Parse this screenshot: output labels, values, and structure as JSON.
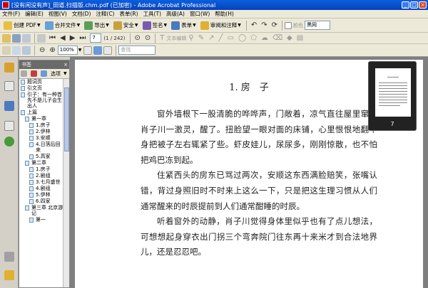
{
  "window": {
    "title": "[没有闲没有声]_田道.扫描版.chm.pdf (已加密) - Adobe Acrobat Professional"
  },
  "menu": [
    "文件(F)",
    "编辑(E)",
    "视图(V)",
    "文档(D)",
    "注释(C)",
    "表单(R)",
    "工具(T)",
    "高级(A)",
    "窗口(W)",
    "帮助(H)"
  ],
  "toolbar1": {
    "create_pdf": "创建 PDF",
    "combine": "合并文件",
    "export": "导出",
    "secure": "安全",
    "sign": "签名",
    "forms": "表单",
    "review": "审阅和注释",
    "color_label": "颜色",
    "color_value": "黑网"
  },
  "toolbar2": {
    "page_current": "7",
    "page_total": "(1 / 242)",
    "text_edit": "文本编辑"
  },
  "toolbar3": {
    "zoom": "100%",
    "search_placeholder": "查找"
  },
  "bookmarks": {
    "title": "书签",
    "close": "×",
    "options": "选项",
    "items": [
      {
        "label": "题词页",
        "level": 0
      },
      {
        "label": "引文页",
        "level": 0
      },
      {
        "label": "引子：有一种首先不是儿子会生出人",
        "level": 0
      },
      {
        "label": "上篇",
        "level": 0
      },
      {
        "label": "第一章",
        "level": 1
      },
      {
        "label": "1.房子",
        "level": 2
      },
      {
        "label": "2.伊林",
        "level": 2
      },
      {
        "label": "3.安顺",
        "level": 2
      },
      {
        "label": "4.日落后回来",
        "level": 2
      },
      {
        "label": "5.高家",
        "level": 2
      },
      {
        "label": "第二章",
        "level": 1
      },
      {
        "label": "1.房子",
        "level": 2
      },
      {
        "label": "2.剧组",
        "level": 2
      },
      {
        "label": "3.七月盛世",
        "level": 2
      },
      {
        "label": "4.剧组",
        "level": 2
      },
      {
        "label": "5.伊林",
        "level": 2
      },
      {
        "label": "6.四家",
        "level": 2
      },
      {
        "label": "第三章 北京游记",
        "level": 1
      },
      {
        "label": "第一",
        "level": 2
      }
    ]
  },
  "document": {
    "heading": "1. 房　子",
    "paragraphs": [
      "窗外墙根下一股清脆的哗哗声，门敞着，凉气直往屋里窜。肖子川一激灵，醒了。扭脸望一眼对面的床铺，心里恨恨地翻个身把被子左右辄紧了些。虾皮娃儿，尿尿多，刚刚惊散，也不怕把鸡巴冻到起。",
      "住紧西头的房东已骂过两次，安顺这东西满脸赔笑，张嘴认错，背过身照旧时不时来上这么一下，只是把这生理习惯从人们通常醒来的时辰提前到人们通常酣睡的时辰。",
      "听着窗外的动静，肖子川觉得身体里似乎也有了点儿想法，可想想起身穿衣出门拐三个弯奔院门往东再十来米才到合法地界儿，还是忍忍吧。"
    ]
  },
  "thumbnail": {
    "page": "7"
  },
  "colors": {
    "titlebar": "#0a5fe0",
    "toolbar": "#ece9d8",
    "workspace": "#7f7f7f"
  }
}
